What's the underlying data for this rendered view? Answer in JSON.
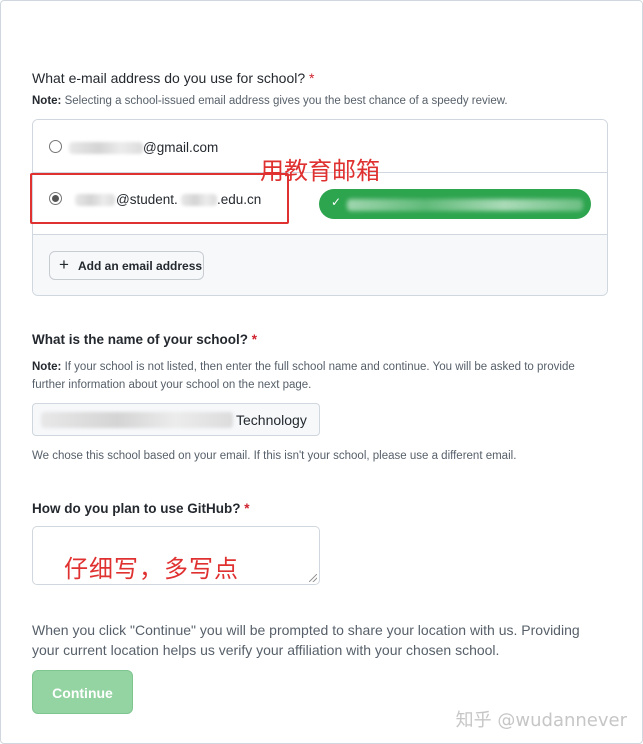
{
  "email_section": {
    "question": "What e-mail address do you use for school?",
    "required_mark": "*",
    "note_prefix": "Note:",
    "note_text": " Selecting a school-issued email address gives you the best chance of a speedy review.",
    "emails": [
      {
        "visible_part": "@gmail.com",
        "selected": false
      },
      {
        "visible_part_a": "@student.",
        "visible_part_b": ".edu.cn",
        "selected": true
      }
    ],
    "add_email_label": "Add an email address",
    "annotation": "用教育邮箱",
    "verified_icon": "check-icon"
  },
  "school_section": {
    "question": "What is the name of your school?",
    "required_mark": "*",
    "note_prefix": "Note:",
    "note_line1": " If your school is not listed, then enter the full school name and continue. You will be asked to provide",
    "note_line2": "further information about your school on the next page.",
    "school_value_visible": "Technology",
    "hint": "We chose this school based on your email. If this isn't your school, please use a different email."
  },
  "usage_section": {
    "question": "How do you plan to use GitHub?",
    "required_mark": "*",
    "textarea_value": "仔细写，多写点"
  },
  "location_text_line1": "When you click \"Continue\" you will be prompted to share your location with us. Providing",
  "location_text_line2": "your current location helps us verify your affiliation with your chosen school.",
  "continue_label": "Continue",
  "watermark": "知乎 @wudannever",
  "colors": {
    "required": "#cf222e",
    "annotation_red": "#e03131",
    "verified_green": "#2da44e",
    "continue_disabled": "#94d3a2"
  }
}
